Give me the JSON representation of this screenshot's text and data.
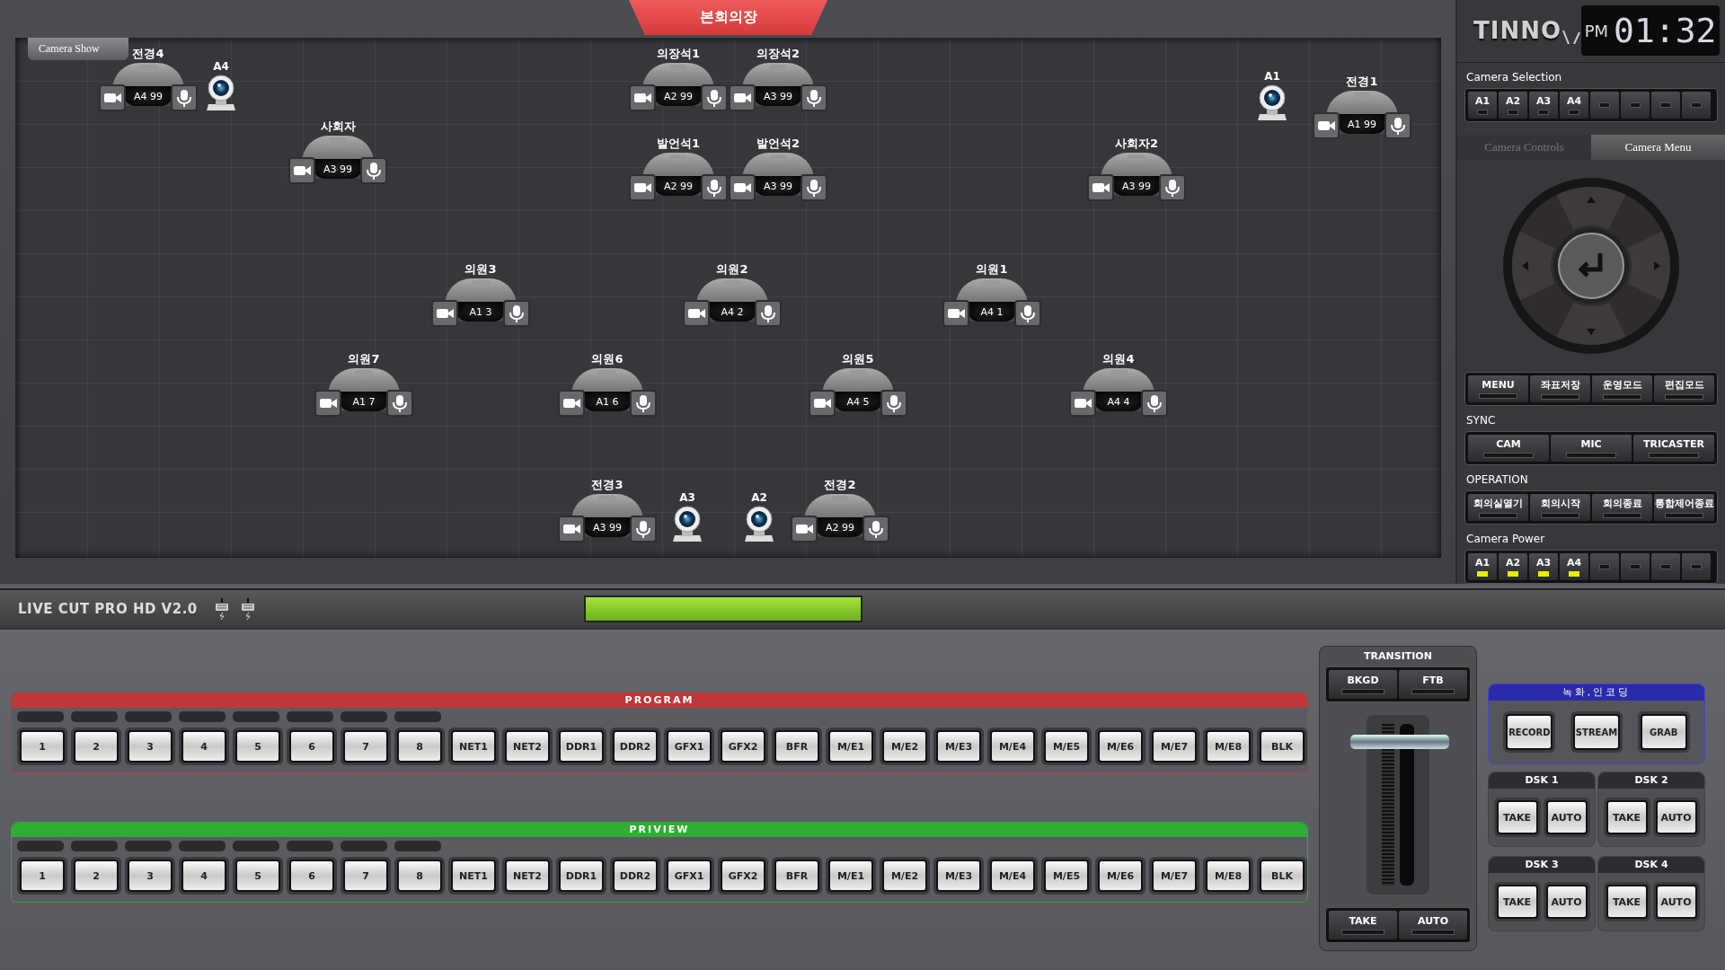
{
  "map": {
    "title": "본회의장",
    "tab": "Camera Show",
    "seats": [
      {
        "name": "전경4",
        "badge": "A4 99"
      },
      {
        "name": "사회자",
        "badge": "A3 99"
      },
      {
        "name": "의장석1",
        "badge": "A2 99"
      },
      {
        "name": "의장석2",
        "badge": "A3 99"
      },
      {
        "name": "발언석1",
        "badge": "A2 99"
      },
      {
        "name": "발언석2",
        "badge": "A3 99"
      },
      {
        "name": "사회자2",
        "badge": "A3 99"
      },
      {
        "name": "전경1",
        "badge": "A1 99"
      },
      {
        "name": "의원3",
        "badge": "A1 3"
      },
      {
        "name": "의원2",
        "badge": "A4 2"
      },
      {
        "name": "의원1",
        "badge": "A4 1"
      },
      {
        "name": "의원7",
        "badge": "A1 7"
      },
      {
        "name": "의원6",
        "badge": "A1 6"
      },
      {
        "name": "의원5",
        "badge": "A4 5"
      },
      {
        "name": "의원4",
        "badge": "A4 4"
      },
      {
        "name": "전경3",
        "badge": "A3 99"
      },
      {
        "name": "전경2",
        "badge": "A2 99"
      }
    ],
    "ptz_cameras": [
      {
        "label": "A4"
      },
      {
        "label": "A1"
      },
      {
        "label": "A3"
      },
      {
        "label": "A2"
      }
    ]
  },
  "logo": "TINNO",
  "clock": {
    "period": "PM",
    "time": "01:32"
  },
  "camera_selection": {
    "title": "Camera Selection",
    "buttons": [
      {
        "label": "A1",
        "on": false
      },
      {
        "label": "A2",
        "on": false
      },
      {
        "label": "A3",
        "on": false
      },
      {
        "label": "A4",
        "on": false
      }
    ]
  },
  "tabs": [
    {
      "label": "Camera Controls",
      "selected": false
    },
    {
      "label": "Camera Menu",
      "selected": true
    }
  ],
  "menu_buttons": [
    "MENU",
    "좌표저장",
    "운영모드",
    "편집모드"
  ],
  "sync": {
    "title": "SYNC",
    "buttons": [
      "CAM",
      "MIC",
      "TRICASTER"
    ]
  },
  "operation": {
    "title": "OPERATION",
    "buttons": [
      "회의실열기",
      "회의시작",
      "회의종료",
      "통합제어종료"
    ]
  },
  "camera_power": {
    "title": "Camera Power",
    "buttons": [
      {
        "label": "A1",
        "on": true
      },
      {
        "label": "A2",
        "on": true
      },
      {
        "label": "A3",
        "on": true
      },
      {
        "label": "A4",
        "on": true
      }
    ]
  },
  "toolbar": {
    "app_name": "LIVE CUT PRO HD V2.0"
  },
  "buses": [
    {
      "kind": "program",
      "title": "PROGRAM",
      "buttons": [
        "1",
        "2",
        "3",
        "4",
        "5",
        "6",
        "7",
        "8",
        "NET1",
        "NET2",
        "DDR1",
        "DDR2",
        "GFX1",
        "GFX2",
        "BFR",
        "M/E1",
        "M/E2",
        "M/E3",
        "M/E4",
        "M/E5",
        "M/E6",
        "M/E7",
        "M/E8",
        "BLK"
      ]
    },
    {
      "kind": "preview",
      "title": "PRIVIEW",
      "buttons": [
        "1",
        "2",
        "3",
        "4",
        "5",
        "6",
        "7",
        "8",
        "NET1",
        "NET2",
        "DDR1",
        "DDR2",
        "GFX1",
        "GFX2",
        "BFR",
        "M/E1",
        "M/E2",
        "M/E3",
        "M/E4",
        "M/E5",
        "M/E6",
        "M/E7",
        "M/E8",
        "BLK"
      ]
    }
  ],
  "transition": {
    "title": "TRANSITION",
    "top_buttons": [
      "BKGD",
      "FTB"
    ],
    "bottom_buttons": [
      "TAKE",
      "AUTO"
    ]
  },
  "recording": {
    "title": "녹화,인코딩",
    "buttons": [
      "RECORD",
      "STREAM",
      "GRAB"
    ]
  },
  "dsk": [
    {
      "title": "DSK 1",
      "buttons": [
        "TAKE",
        "AUTO"
      ]
    },
    {
      "title": "DSK 2",
      "buttons": [
        "TAKE",
        "AUTO"
      ]
    },
    {
      "title": "DSK 3",
      "buttons": [
        "TAKE",
        "AUTO"
      ]
    },
    {
      "title": "DSK 4",
      "buttons": [
        "TAKE",
        "AUTO"
      ]
    }
  ]
}
